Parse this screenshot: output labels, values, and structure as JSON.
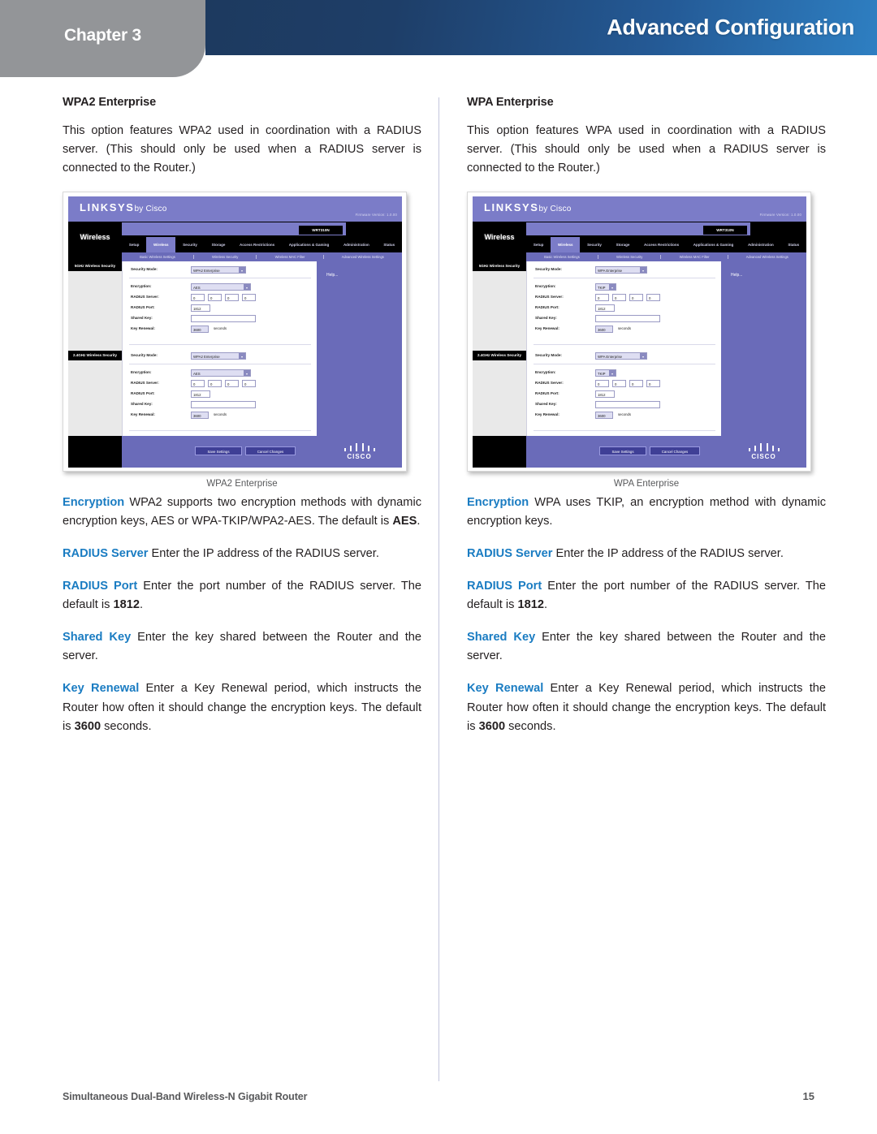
{
  "header": {
    "chapter_label": "Chapter 3",
    "title": "Advanced Configuration",
    "tab_color": "#939598",
    "bar_gradient_start": "#1d3a5f",
    "bar_gradient_end": "#2e7fc2"
  },
  "left_column": {
    "heading": "WPA2 Enterprise",
    "intro": "This option features WPA2 used in coordination with a RADIUS server. (This should only be used when a RADIUS server is connected to the Router.)",
    "figure_caption": "WPA2 Enterprise",
    "definitions": [
      {
        "term": "Encryption",
        "text_before": " WPA2 supports two encryption methods with dynamic encryption keys, AES or WPA-TKIP/WPA2-AES. The default is ",
        "value": "AES",
        "text_after": "."
      },
      {
        "term": "RADIUS Server",
        "text_before": "  Enter the IP address of the RADIUS server.",
        "value": "",
        "text_after": ""
      },
      {
        "term": "RADIUS Port",
        "text_before": "  Enter the port number of the RADIUS server. The default is ",
        "value": "1812",
        "text_after": "."
      },
      {
        "term": "Shared Key",
        "text_before": "  Enter the key shared between the Router and the server.",
        "value": "",
        "text_after": ""
      },
      {
        "term": "Key Renewal",
        "text_before": "  Enter a Key Renewal period, which instructs the Router how often it should change the encryption keys. The default is ",
        "value": "3600",
        "text_after": " seconds."
      }
    ]
  },
  "right_column": {
    "heading": "WPA Enterprise",
    "intro": "This option features WPA used in coordination with a RADIUS server. (This should only be used when a RADIUS server is connected to the Router.)",
    "figure_caption": "WPA Enterprise",
    "definitions": [
      {
        "term": "Encryption",
        "text_before": "  WPA uses TKIP, an encryption method with dynamic encryption keys.",
        "value": "",
        "text_after": ""
      },
      {
        "term": "RADIUS Server",
        "text_before": "  Enter the IP address of the RADIUS server.",
        "value": "",
        "text_after": ""
      },
      {
        "term": "RADIUS Port",
        "text_before": "  Enter the port number of the RADIUS server. The default is ",
        "value": "1812",
        "text_after": "."
      },
      {
        "term": "Shared Key",
        "text_before": "  Enter the key shared between the Router and the server.",
        "value": "",
        "text_after": ""
      },
      {
        "term": "Key Renewal",
        "text_before": "  Enter a Key Renewal period, which instructs the Router how often it should change the encryption keys. The default is ",
        "value": "3600",
        "text_after": " seconds."
      }
    ]
  },
  "screenshot_wpa2": {
    "brand": "LINKSYS",
    "brand_suffix": "by Cisco",
    "firmware": "Firmware Version: 1.0.00",
    "model": "WRT310N",
    "section": "Wireless",
    "tabs": [
      "Setup",
      "Wireless",
      "Security",
      "Storage",
      "Access Restrictions",
      "Applications & Gaming",
      "Administration",
      "Status"
    ],
    "active_tab": "Wireless",
    "subtabs": [
      "Basic Wireless Settings",
      "Wireless Security",
      "Wireless MAC Filter",
      "Advanced Wireless Settings"
    ],
    "active_subtab": "Wireless Security",
    "group_5ghz": "5GHz Wireless Security",
    "group_24ghz": "2.4GHz Wireless Security",
    "help_link": "Help...",
    "fields": {
      "security_mode_label": "Security Mode:",
      "security_mode_value": "WPA2 Enterprise",
      "encryption_label": "Encryption:",
      "encryption_value": "AES",
      "radius_server_label": "RADIUS Server:",
      "radius_server_octets": [
        "0",
        "0",
        "0",
        "0"
      ],
      "radius_port_label": "RADIUS Port:",
      "radius_port_value": "1812",
      "shared_key_label": "Shared Key:",
      "shared_key_value": "",
      "key_renewal_label": "Key Renewal:",
      "key_renewal_value": "3600",
      "key_renewal_unit": "seconds"
    },
    "save_button": "Save Settings",
    "cancel_button": "Cancel Changes",
    "cisco_word": "CISCO"
  },
  "screenshot_wpa": {
    "brand": "LINKSYS",
    "brand_suffix": "by Cisco",
    "firmware": "Firmware Version: 1.0.00",
    "model": "WRT310N",
    "section": "Wireless",
    "tabs": [
      "Setup",
      "Wireless",
      "Security",
      "Storage",
      "Access Restrictions",
      "Applications & Gaming",
      "Administration",
      "Status"
    ],
    "active_tab": "Wireless",
    "subtabs": [
      "Basic Wireless Settings",
      "Wireless Security",
      "Wireless MAC Filter",
      "Advanced Wireless Settings"
    ],
    "active_subtab": "Wireless Security",
    "group_5ghz": "5GHz Wireless Security",
    "group_24ghz": "2.4GHz Wireless Security",
    "help_link": "Help...",
    "fields": {
      "security_mode_label": "Security Mode:",
      "security_mode_value": "WPA Enterprise",
      "encryption_label": "Encryption:",
      "encryption_value": "TKIP",
      "radius_server_label": "RADIUS Server:",
      "radius_server_octets": [
        "0",
        "0",
        "0",
        "0"
      ],
      "radius_port_label": "RADIUS Port:",
      "radius_port_value": "1812",
      "shared_key_label": "Shared Key:",
      "shared_key_value": "",
      "key_renewal_label": "Key Renewal:",
      "key_renewal_value": "3600",
      "key_renewal_unit": "seconds"
    },
    "save_button": "Save Settings",
    "cancel_button": "Cancel Changes",
    "cisco_word": "CISCO"
  },
  "footer": {
    "product": "Simultaneous Dual-Band Wireless-N Gigabit Router",
    "page_number": "15"
  }
}
